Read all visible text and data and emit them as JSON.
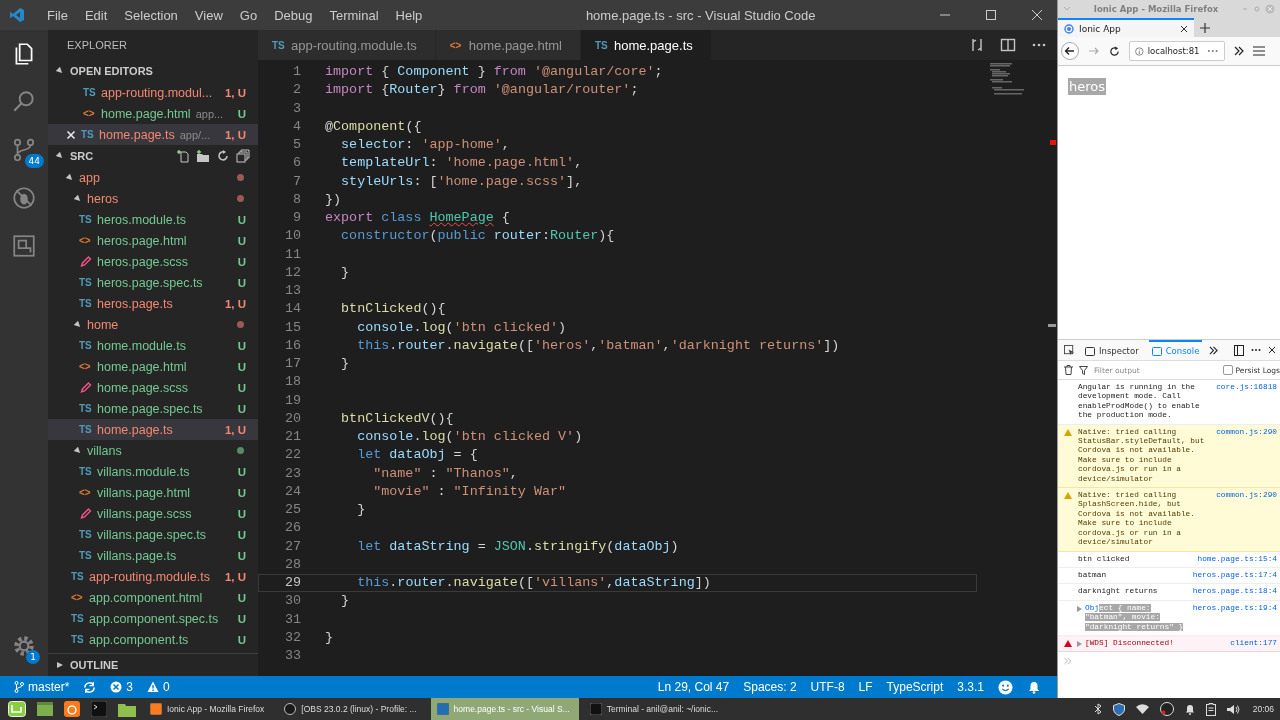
{
  "window": {
    "title": "home.page.ts - src - Visual Studio Code"
  },
  "menu": [
    "File",
    "Edit",
    "Selection",
    "View",
    "Go",
    "Debug",
    "Terminal",
    "Help"
  ],
  "activity_bar": [
    {
      "kind": "files",
      "selected": true
    },
    {
      "kind": "search",
      "selected": false
    },
    {
      "kind": "scm",
      "selected": false,
      "badge": "44"
    },
    {
      "kind": "debug",
      "selected": false
    },
    {
      "kind": "extensions",
      "selected": false
    }
  ],
  "manage": {
    "badge": "1"
  },
  "explorer": {
    "title": "EXPLORER",
    "open_editors": {
      "title": "OPEN EDITORS",
      "expanded": true,
      "items": [
        {
          "kind": "ts",
          "icon": "TS",
          "name": "app-routing.modul...",
          "badge": "1, U",
          "errors": true,
          "selected": false
        },
        {
          "kind": "html",
          "icon": "<>",
          "name": "home.page.html",
          "path": "app...",
          "badge": "U",
          "errors": false,
          "selected": false
        },
        {
          "kind": "ts",
          "icon": "TS",
          "name": "home.page.ts",
          "path": "app/...",
          "badge": "1, U",
          "errors": true,
          "selected": true
        }
      ]
    },
    "folder": {
      "title": "SRC",
      "expanded": true,
      "tree": [
        {
          "kind": "folder",
          "name": "app",
          "expanded": true,
          "errors": true,
          "selected": false,
          "children": [
            {
              "kind": "folder",
              "name": "heros",
              "expanded": true,
              "errors": true,
              "selected": false,
              "children": [
                {
                  "kind": "ts",
                  "icon": "TS",
                  "name": "heros.module.ts",
                  "badge": "U",
                  "errors": false,
                  "selected": false
                },
                {
                  "kind": "html",
                  "icon": "<>",
                  "name": "heros.page.html",
                  "badge": "U",
                  "errors": false,
                  "selected": false
                },
                {
                  "kind": "scss",
                  "name": "heros.page.scss",
                  "badge": "U",
                  "errors": false,
                  "selected": false
                },
                {
                  "kind": "ts",
                  "icon": "TS",
                  "name": "heros.page.spec.ts",
                  "badge": "U",
                  "errors": false,
                  "selected": false
                },
                {
                  "kind": "ts",
                  "icon": "TS",
                  "name": "heros.page.ts",
                  "badge": "1, U",
                  "errors": true,
                  "selected": false
                }
              ]
            },
            {
              "kind": "folder",
              "name": "home",
              "expanded": true,
              "errors": true,
              "selected": false,
              "children": [
                {
                  "kind": "ts",
                  "icon": "TS",
                  "name": "home.module.ts",
                  "badge": "U",
                  "errors": false,
                  "selected": false
                },
                {
                  "kind": "html",
                  "icon": "<>",
                  "name": "home.page.html",
                  "badge": "U",
                  "errors": false,
                  "selected": false
                },
                {
                  "kind": "scss",
                  "name": "home.page.scss",
                  "badge": "U",
                  "errors": false,
                  "selected": false
                },
                {
                  "kind": "ts",
                  "icon": "TS",
                  "name": "home.page.spec.ts",
                  "badge": "U",
                  "errors": false,
                  "selected": false
                },
                {
                  "kind": "ts",
                  "icon": "TS",
                  "name": "home.page.ts",
                  "badge": "1, U",
                  "errors": true,
                  "selected": true
                }
              ]
            },
            {
              "kind": "folder",
              "name": "villans",
              "expanded": true,
              "errors": false,
              "selected": false,
              "children": [
                {
                  "kind": "ts",
                  "icon": "TS",
                  "name": "villans.module.ts",
                  "badge": "U",
                  "errors": false,
                  "selected": false
                },
                {
                  "kind": "html",
                  "icon": "<>",
                  "name": "villans.page.html",
                  "badge": "U",
                  "errors": false,
                  "selected": false
                },
                {
                  "kind": "scss",
                  "name": "villans.page.scss",
                  "badge": "U",
                  "errors": false,
                  "selected": false
                },
                {
                  "kind": "ts",
                  "icon": "TS",
                  "name": "villans.page.spec.ts",
                  "badge": "U",
                  "errors": false,
                  "selected": false
                },
                {
                  "kind": "ts",
                  "icon": "TS",
                  "name": "villans.page.ts",
                  "badge": "U",
                  "errors": false,
                  "selected": false
                }
              ]
            },
            {
              "kind": "ts",
              "icon": "TS",
              "name": "app-routing.module.ts",
              "badge": "1, U",
              "errors": true,
              "selected": false
            },
            {
              "kind": "html",
              "icon": "<>",
              "name": "app.component.html",
              "badge": "U",
              "errors": false,
              "selected": false
            },
            {
              "kind": "ts",
              "icon": "TS",
              "name": "app.component.spec.ts",
              "badge": "U",
              "errors": false,
              "selected": false
            },
            {
              "kind": "ts",
              "icon": "TS",
              "name": "app.component.ts",
              "badge": "U",
              "errors": false,
              "selected": false
            }
          ]
        }
      ]
    },
    "outline": {
      "title": "OUTLINE",
      "expanded": false
    }
  },
  "editor": {
    "tabs": [
      {
        "kind": "ts",
        "icon": "TS",
        "label": "app-routing.module.ts",
        "selected": false
      },
      {
        "kind": "html",
        "icon": "<>",
        "label": "home.page.html",
        "selected": false
      },
      {
        "kind": "ts",
        "icon": "TS",
        "label": "home.page.ts",
        "selected": true
      }
    ],
    "lines": [
      {
        "number": "1",
        "tokens": [
          {
            "text": "import ",
            "kind": "ctrl"
          },
          {
            "text": "{ ",
            "kind": "p"
          },
          {
            "text": "Component",
            "kind": "var"
          },
          {
            "text": " } ",
            "kind": "p"
          },
          {
            "text": "from ",
            "kind": "ctrl"
          },
          {
            "text": "'@angular/core'",
            "kind": "str"
          },
          {
            "text": ";",
            "kind": "p"
          }
        ]
      },
      {
        "number": "2",
        "tokens": [
          {
            "text": "import ",
            "kind": "ctrl"
          },
          {
            "text": "{",
            "kind": "p"
          },
          {
            "text": "Router",
            "kind": "var"
          },
          {
            "text": "} ",
            "kind": "p"
          },
          {
            "text": "from ",
            "kind": "ctrl"
          },
          {
            "text": "'@angular/router'",
            "kind": "str"
          },
          {
            "text": ";",
            "kind": "p"
          }
        ]
      },
      {
        "number": "3"
      },
      {
        "number": "4",
        "tokens": [
          {
            "text": "@",
            "kind": "p"
          },
          {
            "text": "Component",
            "kind": "fn"
          },
          {
            "text": "({",
            "kind": "p"
          }
        ]
      },
      {
        "number": "5",
        "tokens": [
          {
            "text": "  selector",
            "kind": "var"
          },
          {
            "text": ": ",
            "kind": "p"
          },
          {
            "text": "'app-home'",
            "kind": "str"
          },
          {
            "text": ",",
            "kind": "p"
          }
        ]
      },
      {
        "number": "6",
        "tokens": [
          {
            "text": "  templateUrl",
            "kind": "var"
          },
          {
            "text": ": ",
            "kind": "p"
          },
          {
            "text": "'home.page.html'",
            "kind": "str"
          },
          {
            "text": ",",
            "kind": "p"
          }
        ]
      },
      {
        "number": "7",
        "tokens": [
          {
            "text": "  styleUrls",
            "kind": "var"
          },
          {
            "text": ": [",
            "kind": "p"
          },
          {
            "text": "'home.page.scss'",
            "kind": "str"
          },
          {
            "text": "],",
            "kind": "p"
          }
        ]
      },
      {
        "number": "8",
        "tokens": [
          {
            "text": "})",
            "kind": "p"
          }
        ]
      },
      {
        "number": "9",
        "tokens": [
          {
            "text": "export ",
            "kind": "ctrl"
          },
          {
            "text": "class ",
            "kind": "kw"
          },
          {
            "text": "HomePage",
            "kind": "err"
          },
          {
            "text": " {",
            "kind": "p"
          }
        ]
      },
      {
        "number": "10",
        "tokens": [
          {
            "text": "  constructor",
            "kind": "kw"
          },
          {
            "text": "(",
            "kind": "p"
          },
          {
            "text": "public ",
            "kind": "kw"
          },
          {
            "text": "router",
            "kind": "var"
          },
          {
            "text": ":",
            "kind": "p"
          },
          {
            "text": "Router",
            "kind": "type"
          },
          {
            "text": "){",
            "kind": "p"
          }
        ]
      },
      {
        "number": "11"
      },
      {
        "number": "12",
        "tokens": [
          {
            "text": "  }",
            "kind": "p"
          }
        ]
      },
      {
        "number": "13"
      },
      {
        "number": "14",
        "tokens": [
          {
            "text": "  btnClicked",
            "kind": "fn"
          },
          {
            "text": "(){",
            "kind": "p"
          }
        ]
      },
      {
        "number": "15",
        "tokens": [
          {
            "text": "    console",
            "kind": "var"
          },
          {
            "text": ".",
            "kind": "p"
          },
          {
            "text": "log",
            "kind": "fn"
          },
          {
            "text": "(",
            "kind": "p"
          },
          {
            "text": "'btn clicked'",
            "kind": "str"
          },
          {
            "text": ")",
            "kind": "p"
          }
        ]
      },
      {
        "number": "16",
        "tokens": [
          {
            "text": "    this",
            "kind": "kw"
          },
          {
            "text": ".",
            "kind": "p"
          },
          {
            "text": "router",
            "kind": "var"
          },
          {
            "text": ".",
            "kind": "p"
          },
          {
            "text": "navigate",
            "kind": "fn"
          },
          {
            "text": "([",
            "kind": "p"
          },
          {
            "text": "'heros'",
            "kind": "str"
          },
          {
            "text": ",",
            "kind": "p"
          },
          {
            "text": "'batman'",
            "kind": "str"
          },
          {
            "text": ",",
            "kind": "p"
          },
          {
            "text": "'darknight returns'",
            "kind": "str"
          },
          {
            "text": "])",
            "kind": "p"
          }
        ]
      },
      {
        "number": "17",
        "tokens": [
          {
            "text": "  }",
            "kind": "p"
          }
        ]
      },
      {
        "number": "18"
      },
      {
        "number": "19"
      },
      {
        "number": "20",
        "tokens": [
          {
            "text": "  btnClickedV",
            "kind": "fn"
          },
          {
            "text": "(){",
            "kind": "p"
          }
        ]
      },
      {
        "number": "21",
        "tokens": [
          {
            "text": "    console",
            "kind": "var"
          },
          {
            "text": ".",
            "kind": "p"
          },
          {
            "text": "log",
            "kind": "fn"
          },
          {
            "text": "(",
            "kind": "p"
          },
          {
            "text": "'btn clicked V'",
            "kind": "str"
          },
          {
            "text": ")",
            "kind": "p"
          }
        ]
      },
      {
        "number": "22",
        "tokens": [
          {
            "text": "    let ",
            "kind": "kw"
          },
          {
            "text": "dataObj",
            "kind": "var"
          },
          {
            "text": " = {",
            "kind": "p"
          }
        ]
      },
      {
        "number": "23",
        "tokens": [
          {
            "text": "      \"name\"",
            "kind": "str"
          },
          {
            "text": " : ",
            "kind": "p"
          },
          {
            "text": "\"Thanos\"",
            "kind": "str"
          },
          {
            "text": ",",
            "kind": "p"
          }
        ]
      },
      {
        "number": "24",
        "tokens": [
          {
            "text": "      \"movie\"",
            "kind": "str"
          },
          {
            "text": " : ",
            "kind": "p"
          },
          {
            "text": "\"Infinity War\"",
            "kind": "str"
          }
        ]
      },
      {
        "number": "25",
        "tokens": [
          {
            "text": "    }",
            "kind": "p"
          }
        ]
      },
      {
        "number": "26"
      },
      {
        "number": "27",
        "tokens": [
          {
            "text": "    let ",
            "kind": "kw"
          },
          {
            "text": "dataString",
            "kind": "var"
          },
          {
            "text": " = ",
            "kind": "p"
          },
          {
            "text": "JSON",
            "kind": "type"
          },
          {
            "text": ".",
            "kind": "p"
          },
          {
            "text": "stringify",
            "kind": "fn"
          },
          {
            "text": "(",
            "kind": "p"
          },
          {
            "text": "dataObj",
            "kind": "var"
          },
          {
            "text": ")",
            "kind": "p"
          }
        ]
      },
      {
        "number": "28"
      },
      {
        "number": "29",
        "current": true,
        "tokens": [
          {
            "text": "    this",
            "kind": "kw"
          },
          {
            "text": ".",
            "kind": "p"
          },
          {
            "text": "router",
            "kind": "var"
          },
          {
            "text": ".",
            "kind": "p"
          },
          {
            "text": "navigate",
            "kind": "fn"
          },
          {
            "text": "([",
            "kind": "p"
          },
          {
            "text": "'villans'",
            "kind": "str"
          },
          {
            "text": ",",
            "kind": "p"
          },
          {
            "text": "dataString",
            "kind": "var"
          },
          {
            "text": "])",
            "kind": "p"
          }
        ]
      },
      {
        "number": "30",
        "tokens": [
          {
            "text": "  }",
            "kind": "p"
          }
        ]
      },
      {
        "number": "31"
      },
      {
        "number": "32",
        "tokens": [
          {
            "text": "}",
            "kind": "p"
          }
        ]
      },
      {
        "number": "33"
      }
    ]
  },
  "status_bar": {
    "branch": "master*",
    "errors": "3",
    "warnings": "0",
    "items": [
      "Ln 29, Col 47",
      "Spaces: 2",
      "UTF-8",
      "LF",
      "TypeScript",
      "3.3.1"
    ]
  },
  "browser": {
    "title": "Ionic App - Mozilla Firefox",
    "tab": {
      "label": "Ionic App"
    },
    "url": "localhost:81",
    "page_text": {
      "text": "heros",
      "selected": true
    },
    "devtools": {
      "tabs": [
        {
          "label": "Inspector",
          "selected": false
        },
        {
          "label": "Console",
          "selected": true
        }
      ],
      "filter": {
        "placeholder": "Filter output"
      },
      "persist_logs": {
        "label": "Persist Logs",
        "checked": false
      },
      "messages": [
        {
          "kind": "log",
          "text": "Angular is running in the development mode. Call enableProdMode() to enable the production mode.",
          "source": "core.js:16818"
        },
        {
          "kind": "warn",
          "text": "Native: tried calling StatusBar.styleDefault, but Cordova is not available. Make sure to include cordova.js or run in a device/simulator",
          "source": "common.js:290"
        },
        {
          "kind": "warn",
          "text": "Native: tried calling SplashScreen.hide, but Cordova is not available. Make sure to include cordova.js or run in a device/simulator",
          "source": "common.js:290"
        },
        {
          "kind": "log",
          "text": "btn clicked",
          "source": "home.page.ts:15:4"
        },
        {
          "kind": "log",
          "text": "batman",
          "source": "heros.page.ts:17:4"
        },
        {
          "kind": "log",
          "text": "darknight returns",
          "source": "heros.page.ts:18:4"
        },
        {
          "kind": "object",
          "text": "Obj",
          "selected_text": "ect { name: \"batman\", movie: \"darknight returns\" }",
          "source": "heros.page.ts:19:4"
        },
        {
          "kind": "error",
          "text": "[WDS] Disconnected!",
          "source": "client:177"
        }
      ]
    }
  },
  "taskbar": {
    "tasks": [
      {
        "kind": "browser",
        "label": "Ionic App - Mozilla Firefox",
        "selected": false
      },
      {
        "kind": "recorder",
        "label": "[OBS 23.0.2 (linux) - Profile: ...",
        "selected": false
      },
      {
        "kind": "editor",
        "label": "home.page.ts - src - Visual S...",
        "selected": true
      },
      {
        "kind": "terminal",
        "label": "Terminal - anil@anil: ~/ionic...",
        "selected": false
      }
    ],
    "clock": "20:06"
  }
}
